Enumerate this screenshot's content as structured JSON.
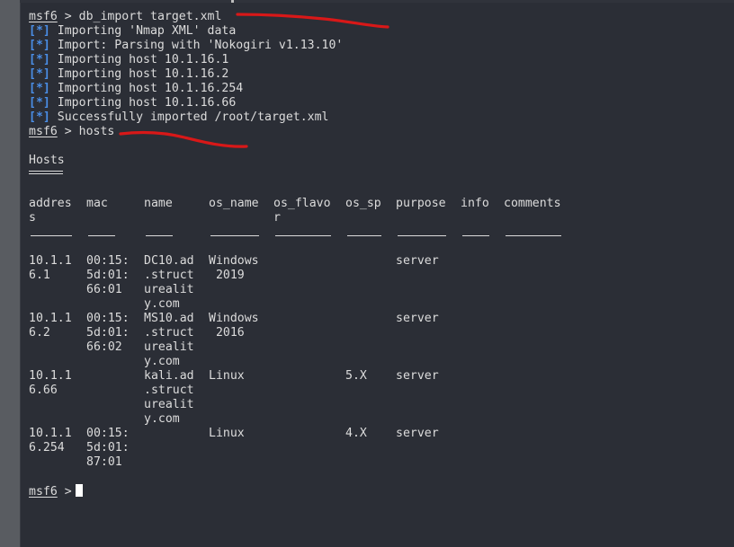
{
  "terminal": {
    "prompt": "msf6",
    "prompt_arrow": ">",
    "cmd1": "db_import target.xml",
    "tag": "[*]",
    "import_lines": [
      "Importing 'Nmap XML' data",
      "Import: Parsing with 'Nokogiri v1.13.10'",
      "Importing host 10.1.16.1",
      "Importing host 10.1.16.2",
      "Importing host 10.1.16.254",
      "Importing host 10.1.16.66",
      "Successfully imported /root/target.xml"
    ],
    "cmd2": "hosts",
    "table_title": "Hosts"
  },
  "hosts_table": {
    "headers": [
      [
        "addres",
        "s"
      ],
      [
        "mac"
      ],
      [
        "name"
      ],
      [
        "os_name"
      ],
      [
        "os_flavo",
        "r"
      ],
      [
        "os_sp"
      ],
      [
        "purpose"
      ],
      [
        "info"
      ],
      [
        "comments"
      ]
    ],
    "rows": [
      [
        [
          "10.1.1",
          "6.1"
        ],
        [
          "00:15:",
          "5d:01:",
          "66:01"
        ],
        [
          "DC10.ad",
          ".struct",
          "urealit",
          "y.com"
        ],
        [
          "Windows",
          " 2019"
        ],
        [],
        [],
        [
          "server"
        ],
        [],
        []
      ],
      [
        [
          "10.1.1",
          "6.2"
        ],
        [
          "00:15:",
          "5d:01:",
          "66:02"
        ],
        [
          "MS10.ad",
          ".struct",
          "urealit",
          "y.com"
        ],
        [
          "Windows",
          " 2016"
        ],
        [],
        [],
        [
          "server"
        ],
        [],
        []
      ],
      [
        [
          "10.1.1",
          "6.66"
        ],
        [],
        [
          "kali.ad",
          ".struct",
          "urealit",
          "y.com"
        ],
        [
          "Linux"
        ],
        [],
        [
          "5.X"
        ],
        [
          "server"
        ],
        [],
        []
      ],
      [
        [
          "10.1.1",
          "6.254"
        ],
        [
          "00:15:",
          "5d:01:",
          "87:01"
        ],
        [],
        [
          "Linux"
        ],
        [],
        [
          "4.X"
        ],
        [
          "server"
        ],
        [],
        []
      ]
    ]
  },
  "colors": {
    "background": "#2b2e36",
    "text": "#dcdcdc",
    "tag": "#4a8ee6",
    "annotation": "#d81818"
  }
}
